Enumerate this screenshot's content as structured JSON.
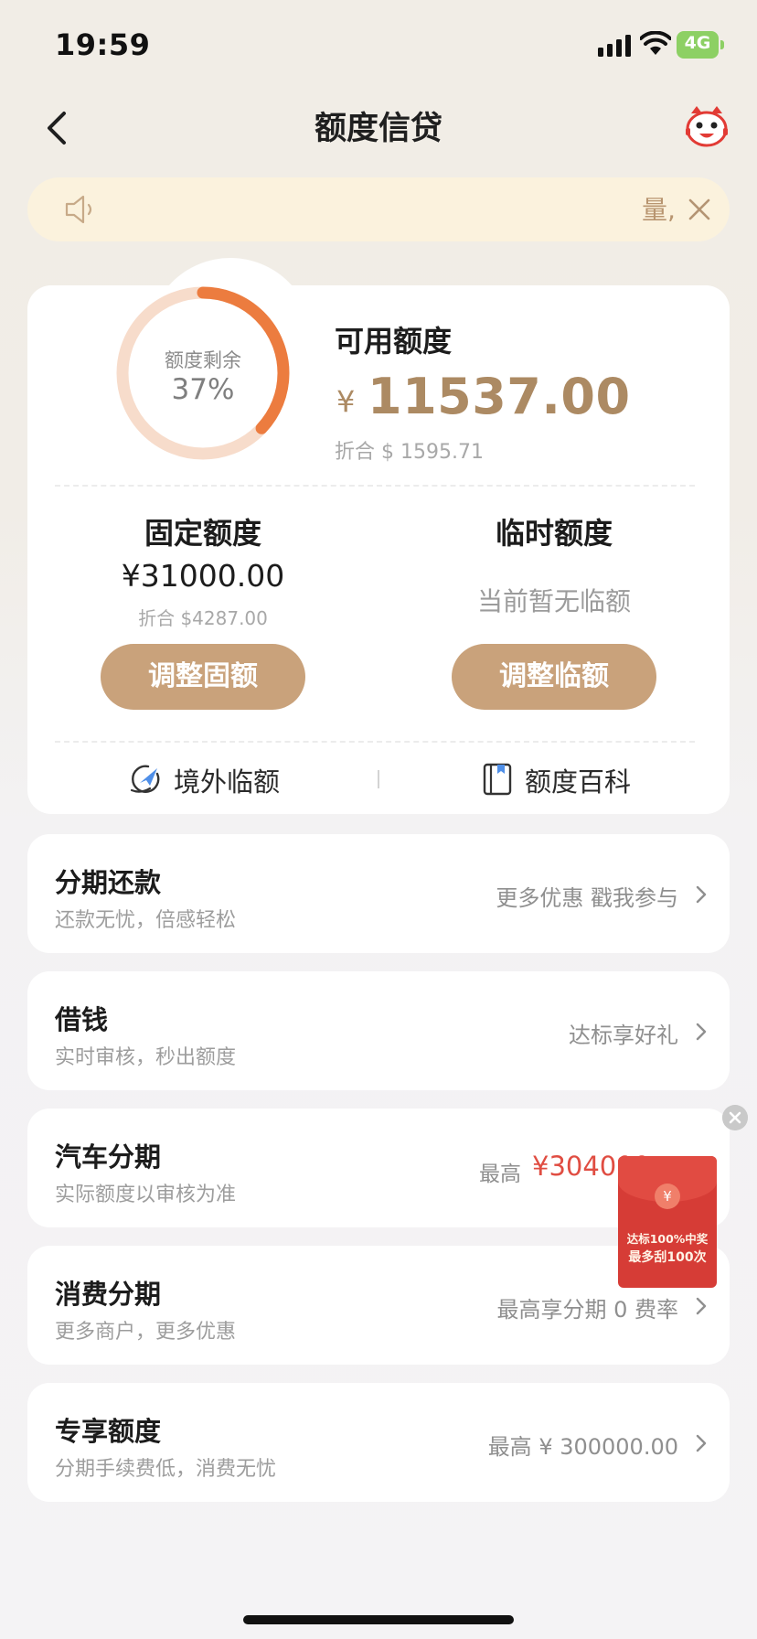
{
  "status_bar": {
    "time": "19:59",
    "network": "4G",
    "icons": [
      "signal-icon",
      "wifi-icon",
      "battery-charging-icon"
    ]
  },
  "nav": {
    "title": "额度信贷",
    "back_icon": "back-chevron-icon",
    "avatar_icon": "mascot-avatar-icon"
  },
  "notice": {
    "text": "量,",
    "icon": "speaker-icon",
    "close_icon": "close-icon"
  },
  "credit": {
    "ring_caption": "额度剩余",
    "remaining_percent_label": "37%",
    "remaining_fraction": 0.37,
    "available_label": "可用额度",
    "currency_symbol": "¥",
    "available_amount": "11537.00",
    "available_converted": "折合 $ 1595.71",
    "fixed": {
      "title": "固定额度",
      "amount": "¥31000.00",
      "converted": "折合 $4287.00",
      "button": "调整固额"
    },
    "temporary": {
      "title": "临时额度",
      "status": "当前暂无临额",
      "button": "调整临额"
    },
    "links": [
      {
        "label": "境外临额",
        "icon": "plane-globe-icon"
      },
      {
        "label": "额度百科",
        "icon": "book-icon"
      }
    ]
  },
  "list": [
    {
      "title": "分期还款",
      "subtitle": "还款无忧，倍感轻松",
      "right": "更多优惠 戳我参与"
    },
    {
      "title": "借钱",
      "subtitle": "实时审核，秒出额度",
      "right": "达标享好礼"
    },
    {
      "title": "汽车分期",
      "subtitle": "实际额度以审核为准",
      "right_prefix": "最高",
      "right_amount": "¥304000"
    },
    {
      "title": "消费分期",
      "subtitle": "更多商户，更多优惠",
      "right": "最高享分期 0 费率"
    },
    {
      "title": "专享额度",
      "subtitle": "分期手续费低，消费无忧",
      "right": "最高 ¥ 300000.00"
    }
  ],
  "promo": {
    "coin": "¥",
    "line1": "达标100%中奖",
    "line2": "最多刮100次",
    "close_icon": "close-icon"
  },
  "colors": {
    "accent_gold": "#c9a27b",
    "amount_gold": "#ac8a63",
    "ring_active": "#ec7c3f",
    "ring_track": "#f7dccb",
    "notice_bg": "#fbf2dd",
    "promo_red": "#d63c36",
    "highlight_red": "#e04d42"
  }
}
